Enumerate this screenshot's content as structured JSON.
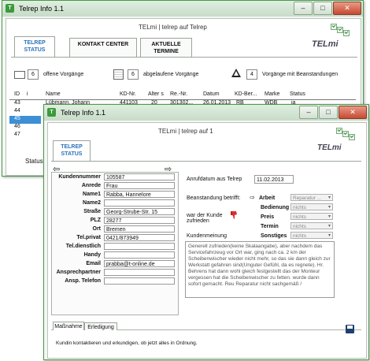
{
  "back_window": {
    "title": "Telrep Info 1.1",
    "app_header": "TELmi | telrep auf Telrep",
    "logo": "TELmi",
    "tabs": [
      {
        "label": "TELREP STATUS"
      },
      {
        "label": "KONTAKT CENTER"
      },
      {
        "label": "AKTUELLE TERMINE"
      }
    ],
    "summary": {
      "open_count": "6",
      "open_label": "offene Vorgänge",
      "expired_count": "6",
      "expired_label": "abgelaufene Vorgänge",
      "complaint_count": "4",
      "complaint_label": "Vorgänge mit Beanstandungen"
    },
    "table": {
      "columns": [
        "ID",
        "i",
        "Name",
        "KD-Nr.",
        "Alter s",
        "Re.-Nr.",
        "Datum",
        "KD-Ber...",
        "Marke",
        "Status"
      ],
      "rows": [
        {
          "id": "43",
          "name": "Lübmann, Johann",
          "kdnr": "441103",
          "alter": "20",
          "renr": "301302...",
          "datum": "26.01.2013",
          "kdber": "RB",
          "marke": "WDB",
          "status": "ja"
        },
        {
          "id": "44"
        },
        {
          "id": "45"
        },
        {
          "id": "46"
        },
        {
          "id": "47"
        }
      ]
    },
    "status_label": "Status"
  },
  "front_window": {
    "title": "Telrep Info 1.1",
    "app_header": "TELmi | telrep auf 1",
    "logo": "TELmi",
    "tab": {
      "label": "TELREP STATUS"
    },
    "nav": {
      "back": "⇦",
      "forward": "⇨"
    },
    "customer": {
      "kundennummer": {
        "label": "Kundennummer",
        "value": "105587"
      },
      "anrede": {
        "label": "Anrede",
        "value": "Frau"
      },
      "name1": {
        "label": "Name1",
        "value": "Rabba, Hannelore"
      },
      "name2": {
        "label": "Name2",
        "value": ""
      },
      "strasse": {
        "label": "Straße",
        "value": "Georg-Strube-Str. 15"
      },
      "plz": {
        "label": "PLZ",
        "value": "28277"
      },
      "ort": {
        "label": "Ort",
        "value": "Bremen"
      },
      "tel_privat": {
        "label": "Tel.privat",
        "value": "0421/873949"
      },
      "tel_dienstlich": {
        "label": "Tel.dienstlich",
        "value": ""
      },
      "handy": {
        "label": "Handy",
        "value": ""
      },
      "email": {
        "label": "Email",
        "value": "prabba@t-online.de"
      },
      "ansprechpartner": {
        "label": "Ansprechpartner",
        "value": ""
      },
      "ansp_telefon": {
        "label": "Ansp. Telefon",
        "value": ""
      }
    },
    "anrufdatum": {
      "label": "Anrufdatum aus Telrep",
      "value": "11.02.2013"
    },
    "beanstandung": {
      "label": "Beanstandung betrifft:",
      "arrow": "⇨",
      "arbeit": {
        "label": "Arbeit",
        "value": "Reparatur ..."
      },
      "bedienung": {
        "label": "Bedienung",
        "value": "nichts"
      },
      "preis": {
        "label": "Preis",
        "value": "nichts"
      },
      "termin": {
        "label": "Termin",
        "value": "nichts"
      },
      "sonstiges": {
        "label": "Sonstiges",
        "value": "nichts"
      }
    },
    "zufrieden_label": "war der Kunde zufrieden",
    "kundenmeinung": {
      "label": "Kundenmeinung",
      "text": "Generell zufrieden(keine Skalaangabe), aber nachdem das Servicefahrzeug vor Ort war, ging nach ca. 2 km der Scheibenwischer wieder nicht mehr, so das sie dann gleich zur Werkstatt gefahren sind(Unguter Gefühl, da es regnete). Hr. Behrens hat dann wohl gleich festgestellt das der Monteur vergessen hat die Scheibenwischer zu fetten. wurde dann sofort gemacht. Reu Reparatur nicht sachgemäß /"
    },
    "bottom_tabs": [
      {
        "label": "Maßnahme"
      },
      {
        "label": "Erledigung"
      }
    ],
    "massnahme_text": "Kundin kontaktieren und erkundigen, ob jetzt alles in Ordnung."
  }
}
